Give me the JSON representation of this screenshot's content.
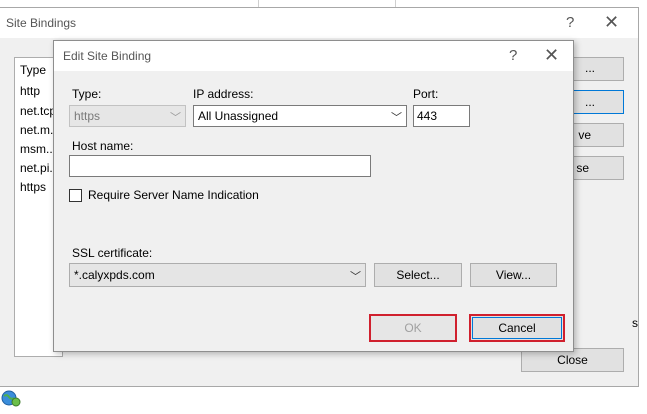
{
  "site_bindings": {
    "title": "Site Bindings",
    "help_glyph": "?",
    "close_glyph": "✕",
    "list_header": "Type",
    "list_items": [
      "http",
      "net.tcp",
      "net.m...",
      "msm...",
      "net.pi...",
      "https"
    ],
    "right_buttons": [
      "...",
      "...",
      "ve",
      "se"
    ],
    "close_button": "Close",
    "right_edge_text": "s"
  },
  "edit_binding": {
    "title": "Edit Site Binding",
    "help_glyph": "?",
    "close_glyph": "✕",
    "type_label": "Type:",
    "type_value": "https",
    "ip_label": "IP address:",
    "ip_value": "All Unassigned",
    "port_label": "Port:",
    "port_value": "443",
    "host_label": "Host name:",
    "host_value": "",
    "sni_label": "Require Server Name Indication",
    "sni_checked": false,
    "ssl_label": "SSL certificate:",
    "ssl_value": "*.calyxpds.com",
    "select_button": "Select...",
    "view_button": "View...",
    "ok_button": "OK",
    "cancel_button": "Cancel",
    "dropdown_glyph": "﹀"
  },
  "colors": {
    "highlight_border": "#d0202e",
    "focus_blue": "#0078d7",
    "dialog_bg": "#f0f0f0"
  }
}
